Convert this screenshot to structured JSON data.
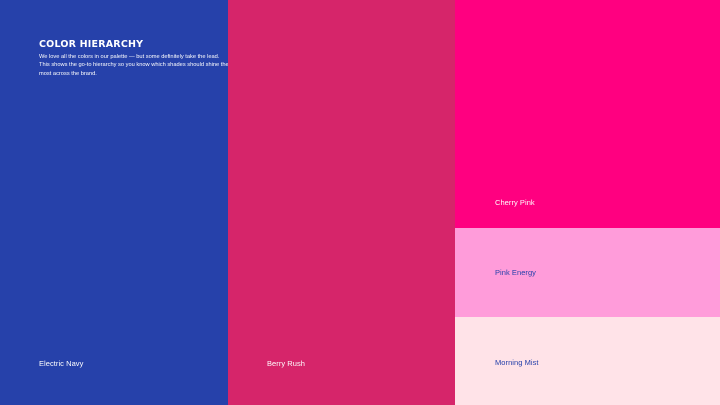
{
  "header": {
    "title": "COLOR HIERARCHY",
    "description": "We love all the colors in our palette — but some definitely take the lead. This shows the go-to hierarchy so you know which shades should shine the most across the brand."
  },
  "colors": {
    "electric_navy": {
      "name": "Electric Navy",
      "hex": "#2641AA",
      "text_color": "#ffffff"
    },
    "berry_rush": {
      "name": "Berry Rush",
      "hex": "#D6256A",
      "text_color": "#ffffff"
    },
    "cherry_pink": {
      "name": "Cherry Pink",
      "hex": "#FF0080",
      "text_color": "#ffffff"
    },
    "pink_energy": {
      "name": "Pink Energy",
      "hex": "#FF9CDA",
      "text_color": "#2641AA"
    },
    "morning_mist": {
      "name": "Morning Mist",
      "hex": "#FFE3E8",
      "text_color": "#2641AA"
    }
  }
}
